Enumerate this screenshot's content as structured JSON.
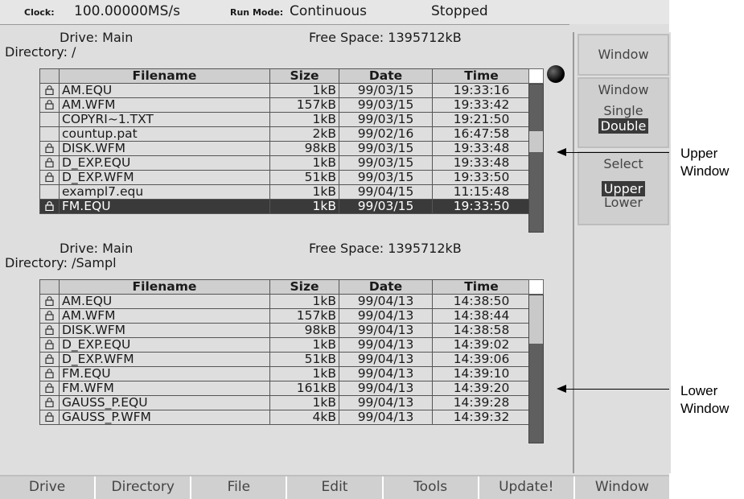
{
  "status": {
    "clock_label": "Clock:",
    "clock_value": "100.00000MS/s",
    "runmode_label": "Run Mode:",
    "runmode_value": "Continuous",
    "state": "Stopped"
  },
  "upper": {
    "drive": "Drive: Main",
    "free": "Free Space: 1395712kB",
    "directory": "Directory: /",
    "columns": [
      "Filename",
      "Size",
      "Date",
      "Time"
    ],
    "rows": [
      {
        "locked": true,
        "name": "AM.EQU",
        "size": "1kB",
        "date": "99/03/15",
        "time": "19:33:16"
      },
      {
        "locked": true,
        "name": "AM.WFM",
        "size": "157kB",
        "date": "99/03/15",
        "time": "19:33:42"
      },
      {
        "locked": false,
        "name": "COPYRI~1.TXT",
        "size": "1kB",
        "date": "99/03/15",
        "time": "19:21:50"
      },
      {
        "locked": false,
        "name": "countup.pat",
        "size": "2kB",
        "date": "99/02/16",
        "time": "16:47:58"
      },
      {
        "locked": true,
        "name": "DISK.WFM",
        "size": "98kB",
        "date": "99/03/15",
        "time": "19:33:48"
      },
      {
        "locked": true,
        "name": "D_EXP.EQU",
        "size": "1kB",
        "date": "99/03/15",
        "time": "19:33:48"
      },
      {
        "locked": true,
        "name": "D_EXP.WFM",
        "size": "51kB",
        "date": "99/03/15",
        "time": "19:33:50"
      },
      {
        "locked": false,
        "name": "exampl7.equ",
        "size": "1kB",
        "date": "99/04/15",
        "time": "11:15:48"
      },
      {
        "locked": true,
        "name": "FM.EQU",
        "size": "1kB",
        "date": "99/03/15",
        "time": "19:33:50",
        "selected": true
      }
    ]
  },
  "lower": {
    "drive": "Drive: Main",
    "free": "Free Space: 1395712kB",
    "directory": "Directory: /Sampl",
    "columns": [
      "Filename",
      "Size",
      "Date",
      "Time"
    ],
    "rows": [
      {
        "locked": true,
        "name": "AM.EQU",
        "size": "1kB",
        "date": "99/04/13",
        "time": "14:38:50"
      },
      {
        "locked": true,
        "name": "AM.WFM",
        "size": "157kB",
        "date": "99/04/13",
        "time": "14:38:44"
      },
      {
        "locked": true,
        "name": "DISK.WFM",
        "size": "98kB",
        "date": "99/04/13",
        "time": "14:38:58"
      },
      {
        "locked": true,
        "name": "D_EXP.EQU",
        "size": "1kB",
        "date": "99/04/13",
        "time": "14:39:02"
      },
      {
        "locked": true,
        "name": "D_EXP.WFM",
        "size": "51kB",
        "date": "99/04/13",
        "time": "14:39:06"
      },
      {
        "locked": true,
        "name": "FM.EQU",
        "size": "1kB",
        "date": "99/04/13",
        "time": "14:39:10"
      },
      {
        "locked": true,
        "name": "FM.WFM",
        "size": "161kB",
        "date": "99/04/13",
        "time": "14:39:20"
      },
      {
        "locked": true,
        "name": "GAUSS_P.EQU",
        "size": "1kB",
        "date": "99/04/13",
        "time": "14:39:28"
      },
      {
        "locked": true,
        "name": "GAUSS_P.WFM",
        "size": "4kB",
        "date": "99/04/13",
        "time": "14:39:32"
      }
    ]
  },
  "side_menu": {
    "title": "Window",
    "mode_label": "Window",
    "mode_single": "Single",
    "mode_double": "Double",
    "select_label": "Select",
    "select_upper": "Upper",
    "select_lower": "Lower"
  },
  "bottom_menu": [
    "Drive",
    "Directory",
    "File",
    "Edit",
    "Tools",
    "Update!",
    "Window"
  ],
  "callouts": {
    "upper_line1": "Upper",
    "upper_line2": "Window",
    "lower_line1": "Lower",
    "lower_line2": "Window"
  },
  "colors": {
    "screen_bg": "#dedede",
    "selected_row_bg": "#3a3a3a",
    "scrollbar": "#5f5f5f",
    "scroll_thumb": "#c9c9c9"
  },
  "icons": {
    "row_lock": "padlock-icon",
    "busy_indicator": "black-ball-icon"
  }
}
